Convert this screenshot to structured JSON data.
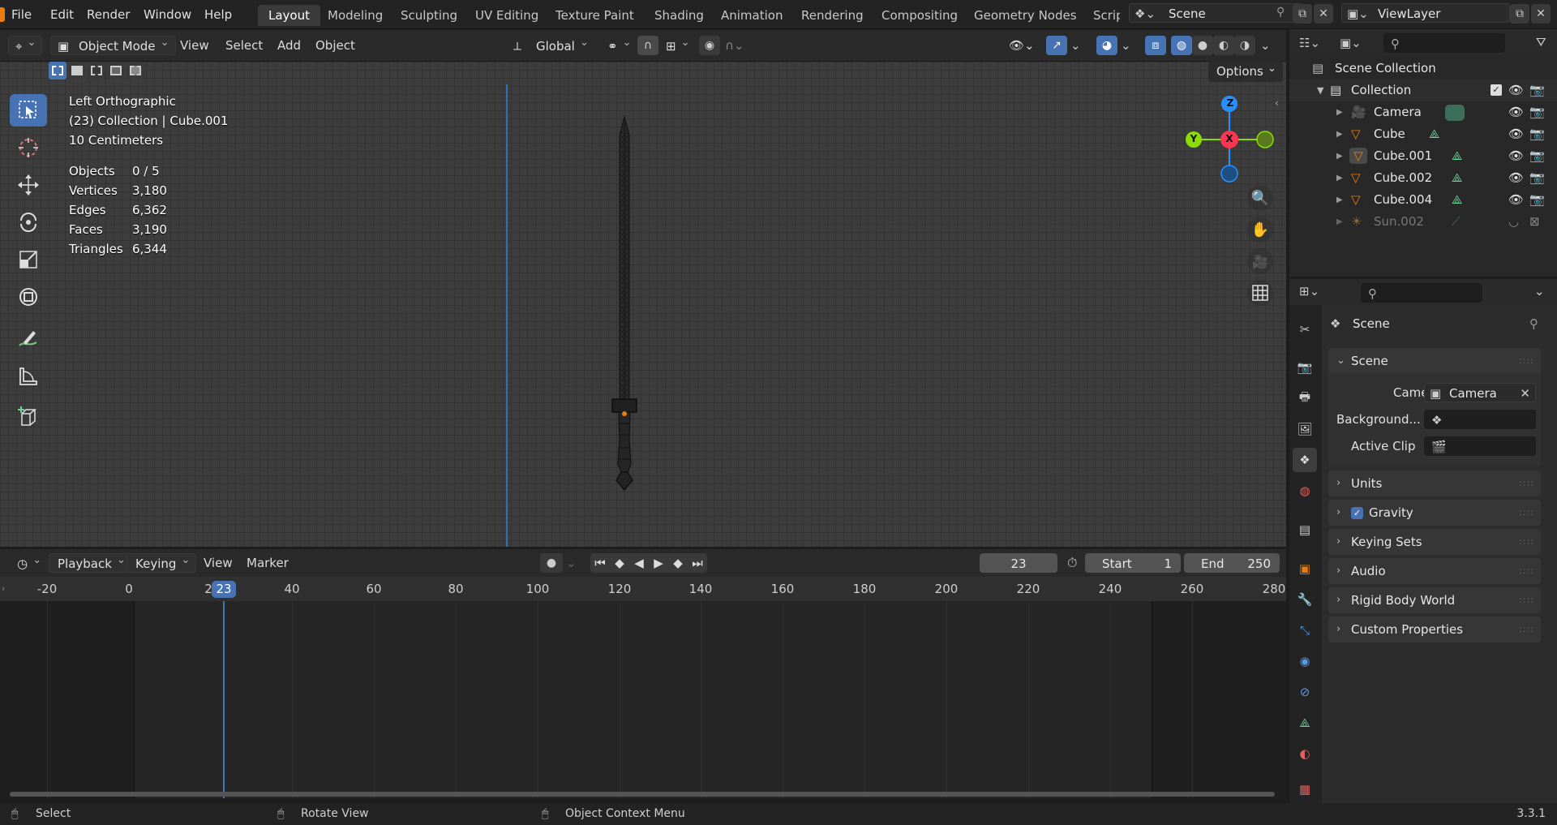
{
  "topbar": {
    "menus": [
      "File",
      "Edit",
      "Render",
      "Window",
      "Help"
    ],
    "workspaces": [
      "Layout",
      "Modeling",
      "Sculpting",
      "UV Editing",
      "Texture Paint",
      "Shading",
      "Animation",
      "Rendering",
      "Compositing",
      "Geometry Nodes",
      "Scripting"
    ],
    "active_workspace": "Layout",
    "scene_name": "Scene",
    "view_layer": "ViewLayer"
  },
  "viewport_header": {
    "mode": "Object Mode",
    "menus": [
      "View",
      "Select",
      "Add",
      "Object"
    ],
    "transform_orientation": "Global",
    "options_label": "Options"
  },
  "viewport": {
    "view_name": "Left Orthographic",
    "collection_info": "(23) Collection | Cube.001",
    "scale_info": "10 Centimeters",
    "stats": [
      {
        "label": "Objects",
        "value": "0 / 5"
      },
      {
        "label": "Vertices",
        "value": "3,180"
      },
      {
        "label": "Edges",
        "value": "6,362"
      },
      {
        "label": "Faces",
        "value": "3,190"
      },
      {
        "label": "Triangles",
        "value": "6,344"
      }
    ],
    "gizmo": {
      "z": "Z",
      "y": "Y",
      "x": "X"
    }
  },
  "timeline": {
    "menus": [
      "Playback",
      "Keying",
      "View",
      "Marker"
    ],
    "current_frame": "23",
    "start_label": "Start",
    "start_value": "1",
    "end_label": "End",
    "end_value": "250",
    "ruler_ticks": [
      "-20",
      "0",
      "2",
      "40",
      "60",
      "80",
      "100",
      "120",
      "140",
      "160",
      "180",
      "200",
      "220",
      "240",
      "260",
      "280"
    ],
    "playhead_label": "23"
  },
  "outliner": {
    "root": "Scene Collection",
    "collection": "Collection",
    "items": [
      {
        "name": "Camera",
        "type": "camera",
        "dimmed": false
      },
      {
        "name": "Cube",
        "type": "mesh",
        "dimmed": false
      },
      {
        "name": "Cube.001",
        "type": "mesh",
        "dimmed": false
      },
      {
        "name": "Cube.002",
        "type": "mesh",
        "dimmed": false
      },
      {
        "name": "Cube.004",
        "type": "mesh",
        "dimmed": false
      },
      {
        "name": "Sun.002",
        "type": "light",
        "dimmed": true
      }
    ]
  },
  "properties": {
    "context_title": "Scene",
    "scene_panel_title": "Scene",
    "camera_label": "Camera",
    "camera_value": "Camera",
    "background_label": "Background...",
    "active_clip_label": "Active Clip",
    "collapsed_panels": [
      "Units",
      "Gravity",
      "Keying Sets",
      "Audio",
      "Rigid Body World",
      "Custom Properties"
    ]
  },
  "statusbar": {
    "left": "Select",
    "middle": "Rotate View",
    "right": "Object Context Menu",
    "version": "3.3.1"
  },
  "colors": {
    "accent": "#4772b3",
    "axis_x": "#ff3352",
    "axis_y": "#8bdc00",
    "axis_z": "#2890ff",
    "object_orange": "#e87d0d",
    "mesh_green": "#6fd49a"
  }
}
